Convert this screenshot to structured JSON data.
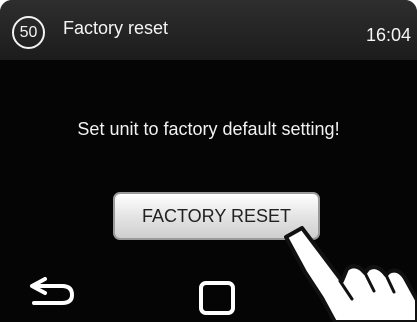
{
  "header": {
    "badge": "50",
    "title": "Factory reset",
    "time": "16:04"
  },
  "main": {
    "message": "Set unit to factory default setting!",
    "reset_button_label": "FACTORY RESET"
  },
  "navigation": {
    "back_icon": "back-arrow-icon",
    "home_icon": "home-square-icon",
    "pointer_icon": "tapping-hand-icon"
  },
  "colors": {
    "background": "#050505",
    "header": "#262626",
    "text": "#f2f2f2",
    "button": "#e2e2e2"
  }
}
